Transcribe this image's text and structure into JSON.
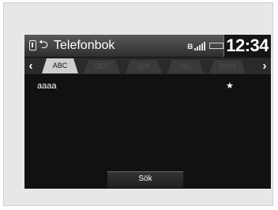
{
  "header": {
    "back_symbol": "⮌",
    "title": "Telefonbok",
    "bluetooth_symbol": "ʙ",
    "time": "12:34"
  },
  "tabs": [
    {
      "label": "ABC",
      "active": true
    },
    {
      "label": "DEF",
      "active": false
    },
    {
      "label": "GHI",
      "active": false
    },
    {
      "label": "JKL",
      "active": false
    },
    {
      "label": "MNO",
      "active": false
    }
  ],
  "nav": {
    "prev_symbol": "‹",
    "next_symbol": "›"
  },
  "contacts": [
    {
      "name": "aaaa",
      "favorite_symbol": "★"
    }
  ],
  "search_button": {
    "label": "Sök"
  },
  "icons": {
    "phone": "phone-icon",
    "back": "back-icon",
    "bluetooth": "bluetooth-icon",
    "signal": "signal-icon",
    "battery": "battery-icon",
    "favorite": "star-icon"
  },
  "colors": {
    "screen_background": "#111111",
    "active_tab": "#cfcfcf",
    "text": "#ffffff"
  }
}
